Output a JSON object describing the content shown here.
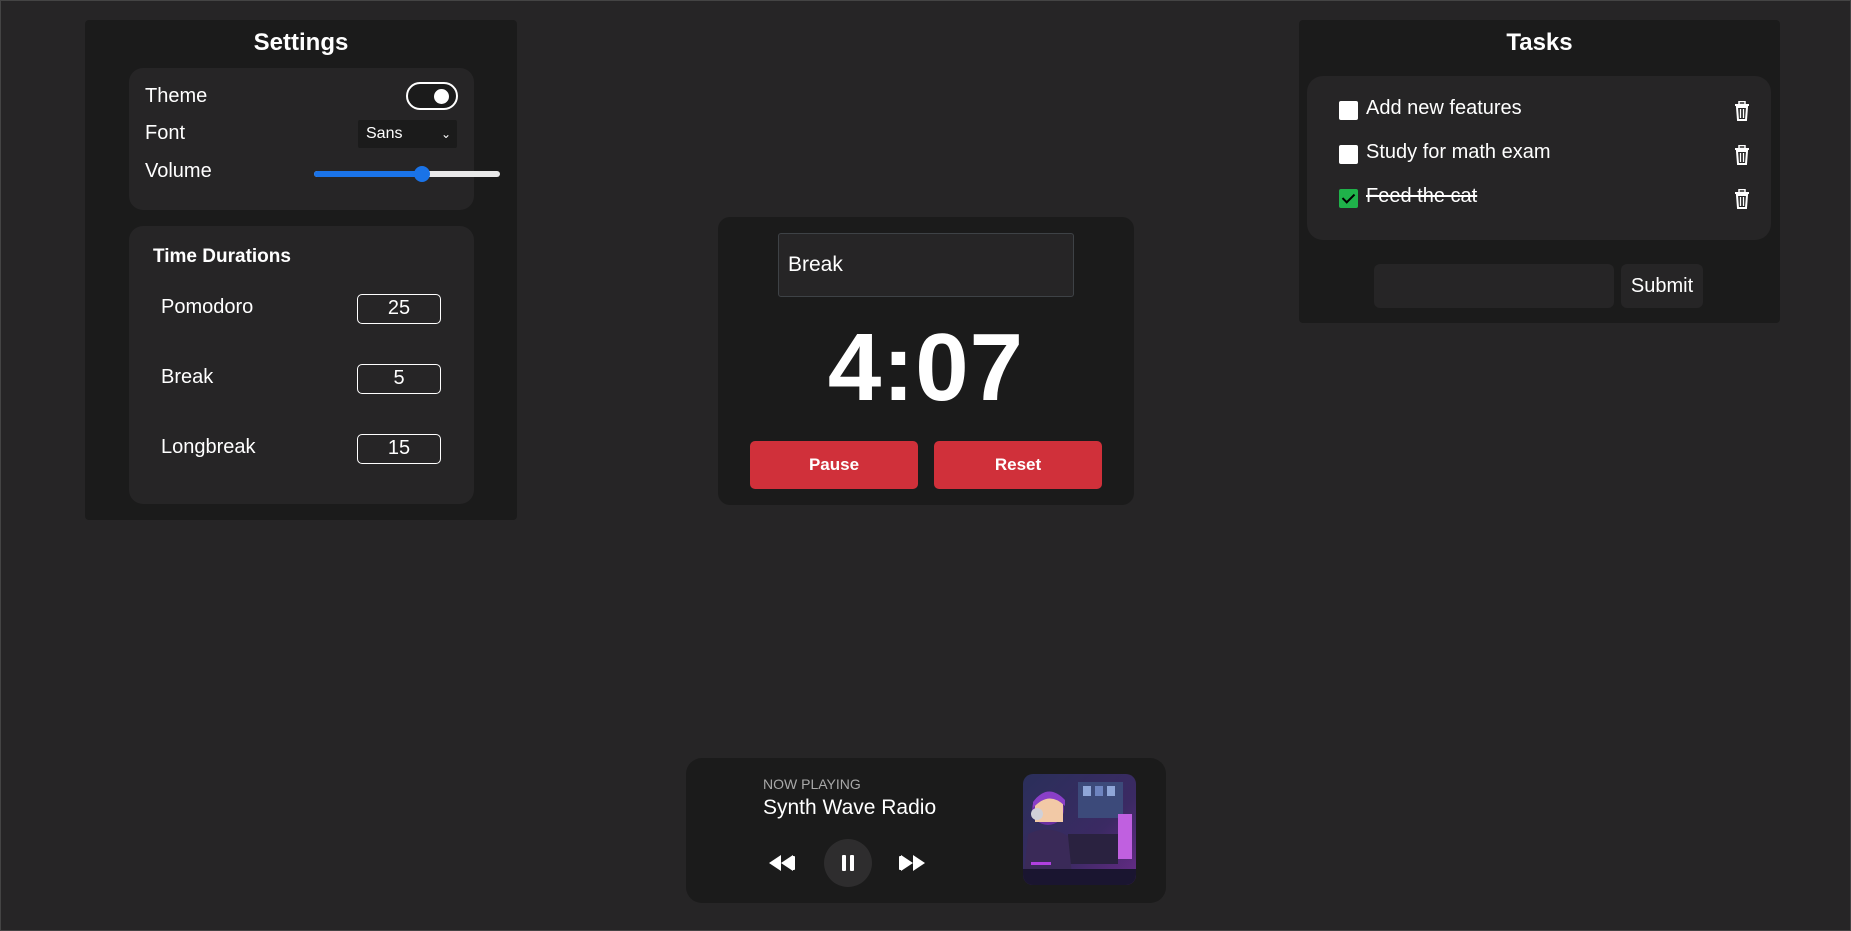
{
  "settings": {
    "title": "Settings",
    "theme_label": "Theme",
    "theme_on": true,
    "font_label": "Font",
    "font_value": "Sans",
    "volume_label": "Volume",
    "volume_fraction": 0.58,
    "durations_title": "Time Durations",
    "durations": [
      {
        "label": "Pomodoro",
        "value": "25"
      },
      {
        "label": "Break",
        "value": "5"
      },
      {
        "label": "Longbreak",
        "value": "15"
      }
    ]
  },
  "timer": {
    "mode": "Break",
    "time": "4:07",
    "pause_label": "Pause",
    "reset_label": "Reset",
    "button_color": "#d0303a"
  },
  "tasks": {
    "title": "Tasks",
    "items": [
      {
        "text": "Add new features",
        "done": false
      },
      {
        "text": "Study for math exam",
        "done": false
      },
      {
        "text": "Feed the cat",
        "done": true
      }
    ],
    "input_value": "",
    "submit_label": "Submit",
    "check_color": "#1fb24a"
  },
  "player": {
    "now_playing_label": "NOW PLAYING",
    "station": "Synth Wave Radio",
    "icons": [
      "rewind-icon",
      "pause-icon",
      "fast-forward-icon"
    ]
  }
}
